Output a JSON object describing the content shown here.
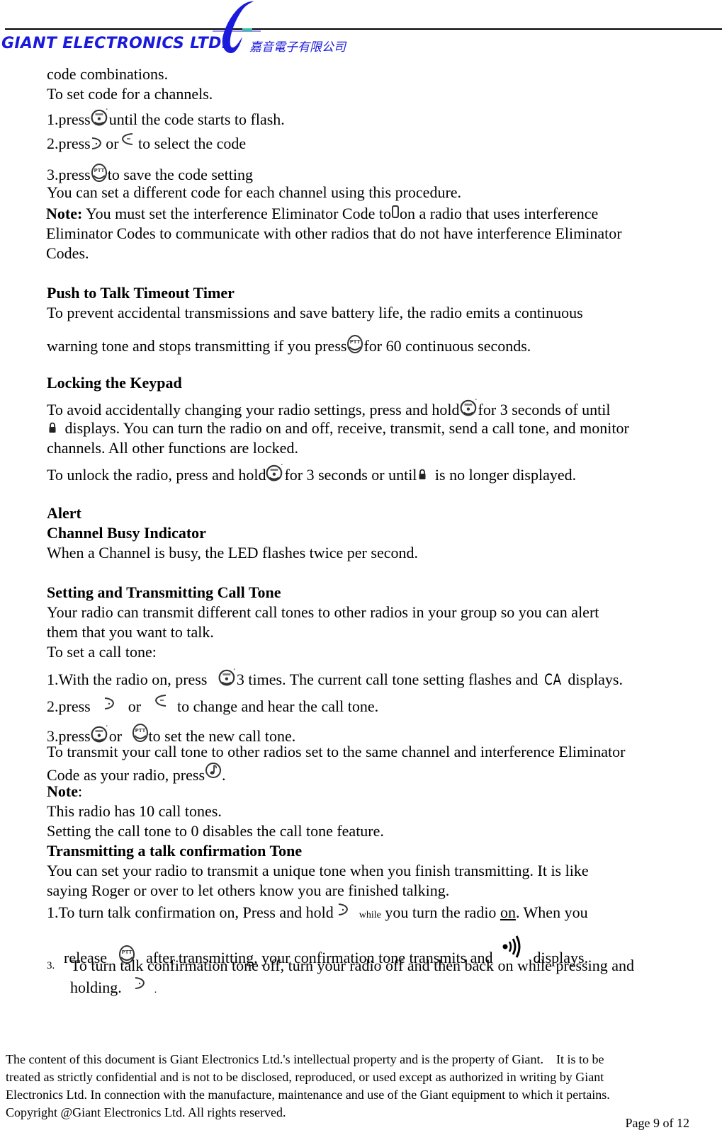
{
  "header": {
    "company_name": "GIANT ELECTRONICS LTD.",
    "company_name_cn": "嘉音電子有限公司",
    "brand_color": "#1a1adc",
    "logo_accent_color": "#33c6a0"
  },
  "intro": {
    "line1": "code combinations.",
    "line2": "To set code for a channels.",
    "step1_pre": "1.press",
    "step1_post": "until the code starts to flash.",
    "step2_pre": "2.press ",
    "step2_mid": "or",
    "step2_post": " to select the code",
    "step3_pre": "3.press",
    "step3_post": "to save the code setting",
    "line_procedure": "You can set a different code for each channel using this procedure.",
    "note_label": "Note:",
    "note_pre": " You must set the interference Eliminator Code to",
    "note_post": "on a radio that uses interference",
    "note_line2": "Eliminator Codes to communicate with other radios that do not have interference Eliminator",
    "note_line3": "Codes."
  },
  "ptt_timer": {
    "heading": "Push to Talk Timeout Timer",
    "line1": "To prevent accidental transmissions and save battery life, the radio emits a continuous",
    "line2_pre": "warning tone and stops transmitting if you press",
    "line2_post": "for 60 continuous seconds."
  },
  "keypad_lock": {
    "heading": "Locking the Keypad",
    "line1_pre": "To avoid accidentally changing your radio settings, press and hold",
    "line1_post": "for 3 seconds of until",
    "line2": " displays. You can turn the radio on and off, receive, transmit, send a call tone, and monitor",
    "line3": "channels. All other functions are locked.",
    "line4_pre": "To unlock the radio, press and hold",
    "line4_mid": "for 3 seconds or until",
    "line4_post": " is no longer displayed."
  },
  "alert": {
    "heading": "Alert",
    "subheading": "Channel Busy Indicator",
    "line1": "When a Channel is busy, the LED flashes twice per second."
  },
  "call_tone": {
    "heading": "Setting and Transmitting Call Tone",
    "line1": "Your radio can transmit different call tones to other radios in your group so you can alert",
    "line2": "them that you want to talk.",
    "line3": "To set a call tone:",
    "step1_pre": "1.With the radio on, press ",
    "step1_post": "3 times. The current call tone setting flashes and ",
    "step1_code": "CA",
    "step1_end": " displays.",
    "step2_pre": "2.press ",
    "step2_mid": " or ",
    "step2_post": " to change and hear the call tone.",
    "step3_pre": "3.press",
    "step3_mid": "or ",
    "step3_post": "to set the new call tone.",
    "transmit_line1": "To transmit your call tone to other radios set to the same channel and interference Eliminator",
    "transmit_line2_pre": "Code as your radio, press",
    "transmit_line2_post": ".",
    "note_label": "Note",
    "note_colon": ":",
    "note_line1": "This radio has 10 call tones.",
    "note_line2": "Setting the call tone to 0 disables the call tone feature."
  },
  "talk_confirm": {
    "heading": "Transmitting a talk confirmation Tone",
    "line1": "You can set your radio to transmit a unique tone when you finish transmitting. It is like",
    "line2": "saying Roger or over to let others know you are finished talking.",
    "step1_pre": "1.To turn talk confirmation on, Press and hold",
    "step1_small": "while",
    "step1_mid": " you turn the radio ",
    "step1_on": "on",
    "step1_post": ". When you",
    "step1b_pre": "release ",
    "step1b_mid": " after transmitting, your confirmation tone transmits and ",
    "step1b_post": " displays.",
    "step3_num": "3.",
    "step3_line1": "To turn talk confirmation tone off, turn your radio off and then back on while pressing and",
    "step3_line2": "holding.",
    "step3_end": "."
  },
  "footer": {
    "line1": "The content of this document is Giant Electronics Ltd.'s intellectual property and is the property of Giant.    It is to be",
    "line2": "treated as strictly confidential and is not to be disclosed, reproduced, or used except as authorized in writing by Giant",
    "line3": "Electronics Ltd. In connection with the manufacture, maintenance and use of the Giant equipment to which it pertains.",
    "line4": "Copyright @Giant Electronics Ltd. All rights reserved.",
    "page": "Page 9 of 12"
  },
  "icons": {
    "menu_button": "menu-button-icon",
    "ptt_button": "ptt-button-icon",
    "up_arrow": "up-arrow-button-icon",
    "down_arrow": "down-arrow-button-icon",
    "lock": "lock-icon",
    "call_tone": "music-note-button-icon",
    "signal": "signal-waves-icon",
    "blank_code": "blank-digit-icon"
  }
}
